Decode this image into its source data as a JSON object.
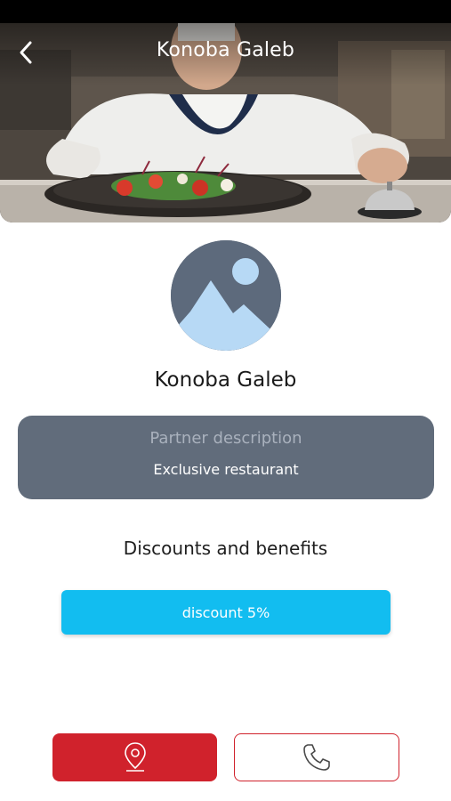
{
  "header": {
    "title": "Konoba Galeb",
    "back_icon": "chevron-left-icon",
    "hero_image": "chef-serving-salad-photo"
  },
  "partner": {
    "logo_icon": "image-placeholder-icon",
    "name": "Konoba Galeb"
  },
  "description": {
    "title": "Partner description",
    "text": "Exclusive restaurant"
  },
  "benefits": {
    "title": "Discounts and benefits",
    "items": [
      {
        "label": "discount 5%"
      }
    ]
  },
  "actions": {
    "location_icon": "map-pin-icon",
    "phone_icon": "phone-icon"
  },
  "colors": {
    "accent_red": "#d0222c",
    "discount_blue": "#12bdf0",
    "card_gray": "#616c7b",
    "avatar_bg": "#5d6a7c",
    "avatar_shape": "#b7d9f5"
  }
}
